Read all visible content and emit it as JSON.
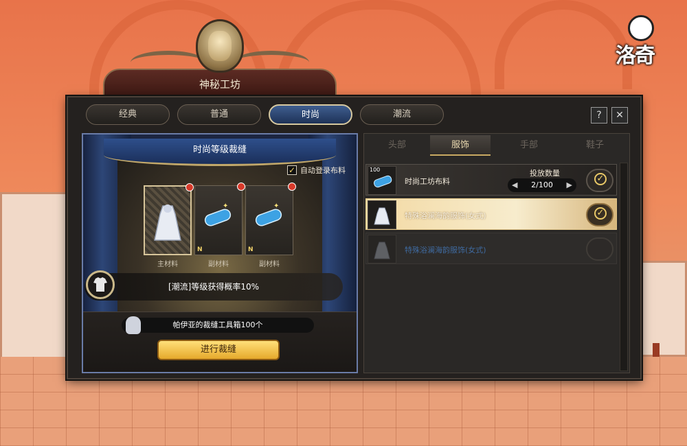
{
  "brand": {
    "logo_text": "洛奇"
  },
  "window": {
    "title": "神秘工坊",
    "tabs": [
      "经典",
      "普通",
      "时尚",
      "潮流"
    ],
    "active_tab": "时尚",
    "help_label": "?",
    "close_label": "✕"
  },
  "left_panel": {
    "title": "时尚等级裁缝",
    "auto_register": {
      "label": "自动登录布料",
      "checked": true
    },
    "slots": [
      {
        "label": "主材料",
        "badge": "",
        "item": "dress-icon"
      },
      {
        "label": "副材料",
        "badge": "N",
        "item": "fabric-roll-icon"
      },
      {
        "label": "副材料",
        "badge": "N",
        "item": "fabric-roll-icon"
      }
    ],
    "probability_text": "[潮流]等级获得概率10%",
    "tool_text": "帕伊亚的裁缝工具箱100个",
    "craft_button": "进行裁缝"
  },
  "right_panel": {
    "category_tabs": [
      "头部",
      "服饰",
      "手部",
      "鞋子"
    ],
    "active_category": "服饰",
    "items": [
      {
        "name": "时尚工坊布料",
        "thumb_badge": "100",
        "qty_label": "投放数量",
        "qty_value": "2/100",
        "checked": true,
        "state": "normal"
      },
      {
        "name": "特殊浴澜海韵服饰(女式)",
        "checked": true,
        "state": "highlighted"
      },
      {
        "name": "特殊浴澜海韵服饰(女式)",
        "checked": false,
        "state": "disabled"
      }
    ]
  },
  "colors": {
    "accent_gold": "#f3d36a",
    "active_tab_blue": "#3f5e8f",
    "disabled_text": "#3f6aa0"
  }
}
